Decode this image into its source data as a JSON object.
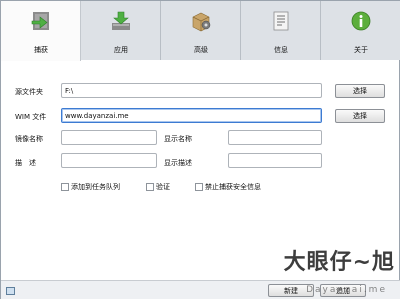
{
  "tabs": [
    {
      "label": "捕获",
      "icon": "capture-icon",
      "active": true
    },
    {
      "label": "应用",
      "icon": "apply-download-icon",
      "active": false
    },
    {
      "label": "高级",
      "icon": "advanced-package-icon",
      "active": false
    },
    {
      "label": "信息",
      "icon": "info-document-icon",
      "active": false
    },
    {
      "label": "关于",
      "icon": "about-info-icon",
      "active": false
    }
  ],
  "form": {
    "source_label": "源文件夹",
    "source_value": "F:\\",
    "source_button": "选择",
    "wim_label": "WIM 文件",
    "wim_value": "www.dayanzai.me",
    "wim_button": "选择",
    "image_name_label": "镜像名称",
    "image_name_value": "",
    "display_name_label": "显示名称",
    "display_name_value": "",
    "description_label": "描　述",
    "description_value": "",
    "display_description_label": "显示描述",
    "display_description_value": ""
  },
  "options": {
    "queue_label": "添加到任务队列",
    "verify_label": "验证",
    "disable_security_label": "禁止捕获安全信息"
  },
  "footer": {
    "new_button": "新建",
    "add_button": "追加"
  },
  "watermark": {
    "text": "大眼仔~旭",
    "sub": "Dayanzai.me"
  },
  "colors": {
    "active_tab": "#fbfbfb",
    "tab_bg": "#dde1e6",
    "icon_green": "#5cae3c",
    "focus_border": "#3d7bd2"
  }
}
